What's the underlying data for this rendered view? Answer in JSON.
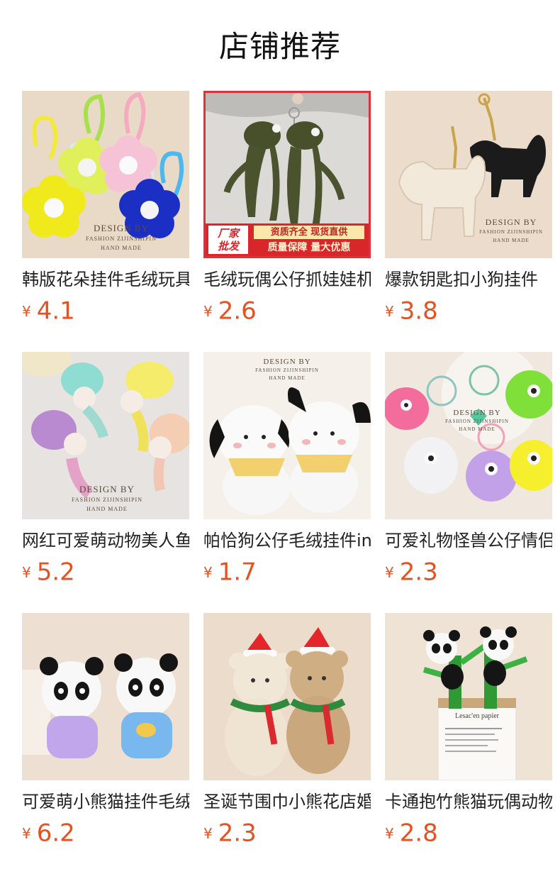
{
  "section": {
    "title": "店铺推荐"
  },
  "products": [
    {
      "title": "韩版花朵挂件毛绒玩具",
      "currency": "¥",
      "price": "4.1",
      "watermark": [
        "DESIGN BY",
        "FASHION ZIJINSHIPIN",
        "HAND MADE"
      ]
    },
    {
      "title": "毛绒玩偶公仔抓娃娃机",
      "currency": "¥",
      "price": "2.6",
      "badge": {
        "left": [
          "厂家",
          "批发"
        ],
        "right_top": "资质齐全 现货直供",
        "right_bottom": "质量保障 量大优惠"
      }
    },
    {
      "title": "爆款钥匙扣小狗挂件",
      "currency": "¥",
      "price": "3.8",
      "watermark": [
        "DESIGN BY",
        "FASHION ZIJINSHIPIN",
        "HAND MADE"
      ]
    },
    {
      "title": "网红可爱萌动物美人鱼",
      "currency": "¥",
      "price": "5.2",
      "watermark": [
        "DESIGN BY",
        "FASHION ZIJINSHIPIN",
        "HAND MADE"
      ]
    },
    {
      "title": "帕恰狗公仔毛绒挂件ins",
      "currency": "¥",
      "price": "1.7",
      "watermark": [
        "DESIGN BY",
        "FASHION ZIJINSHIPIN",
        "HAND MADE"
      ]
    },
    {
      "title": "可爱礼物怪兽公仔情侣",
      "currency": "¥",
      "price": "2.3",
      "watermark": [
        "DESIGN BY",
        "FASHION ZIJINSHIPIN",
        "HAND MADE"
      ]
    },
    {
      "title": "可爱萌小熊猫挂件毛绒",
      "currency": "¥",
      "price": "6.2"
    },
    {
      "title": "圣诞节围巾小熊花店婚",
      "currency": "¥",
      "price": "2.3"
    },
    {
      "title": "卡通抱竹熊猫玩偶动物",
      "currency": "¥",
      "price": "2.8",
      "watermark": [
        "Lesac'en papier"
      ]
    }
  ],
  "colors": {
    "price": "#e8501f",
    "badge_red": "#d8262b",
    "title_text": "#222222"
  }
}
